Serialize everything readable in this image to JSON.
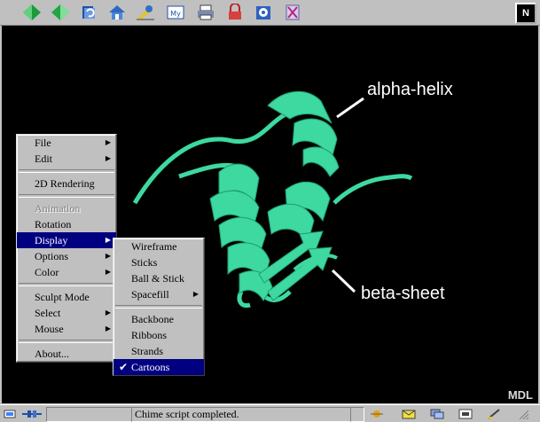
{
  "toolbar": {
    "buttons": [
      "back-icon",
      "forward-icon",
      "reload-icon",
      "home-icon",
      "search-icon",
      "my-netscape-icon",
      "print-icon",
      "security-icon",
      "shop-icon",
      "stop-icon"
    ],
    "logo": "N"
  },
  "viewer": {
    "label_helix": "alpha-helix",
    "label_sheet": "beta-sheet",
    "brand": "MDL",
    "ribbon_color": "#3dd9a0"
  },
  "context_menu": {
    "items": [
      {
        "label": "File",
        "submenu": true
      },
      {
        "label": "Edit",
        "submenu": true
      },
      {
        "label": "2D Rendering"
      },
      {
        "label": "Animation",
        "disabled": true
      },
      {
        "label": "Rotation"
      },
      {
        "label": "Display",
        "submenu": true,
        "highlighted": true
      },
      {
        "label": "Options",
        "submenu": true
      },
      {
        "label": "Color",
        "submenu": true
      },
      {
        "label": "Sculpt Mode"
      },
      {
        "label": "Select",
        "submenu": true
      },
      {
        "label": "Mouse",
        "submenu": true
      },
      {
        "label": "About..."
      }
    ]
  },
  "display_submenu": {
    "items": [
      {
        "label": "Wireframe"
      },
      {
        "label": "Sticks"
      },
      {
        "label": "Ball & Stick"
      },
      {
        "label": "Spacefill",
        "submenu": true
      },
      {
        "label": "Backbone"
      },
      {
        "label": "Ribbons"
      },
      {
        "label": "Strands"
      },
      {
        "label": "Cartoons",
        "checked": true,
        "highlighted": true
      }
    ]
  },
  "statusbar": {
    "message": "Chime script completed."
  }
}
